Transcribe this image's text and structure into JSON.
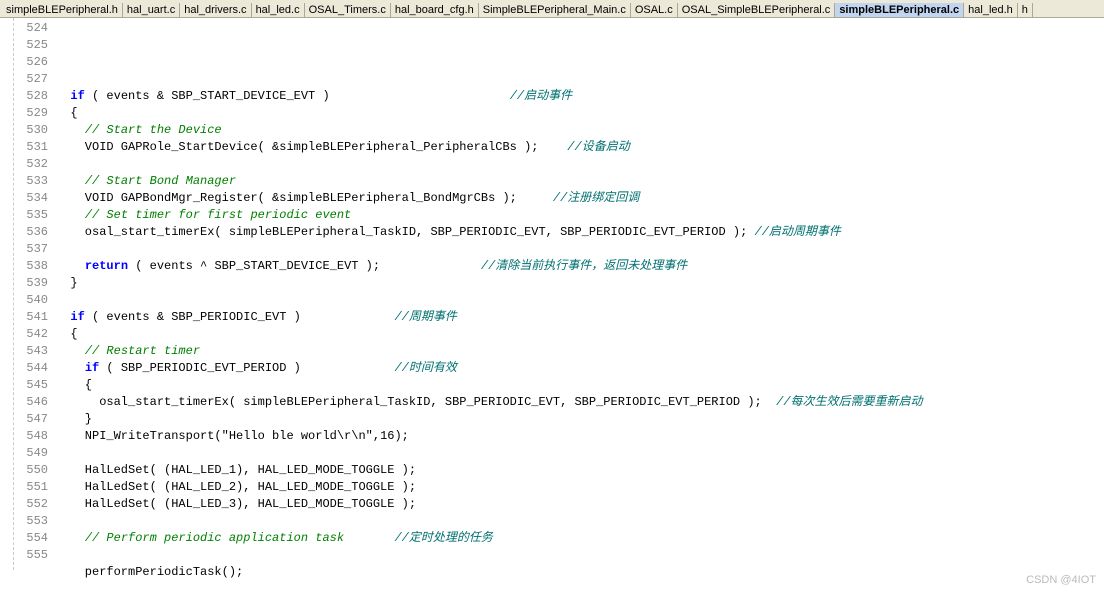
{
  "tabs": [
    {
      "label": "simpleBLEPeripheral.h",
      "active": false
    },
    {
      "label": "hal_uart.c",
      "active": false
    },
    {
      "label": "hal_drivers.c",
      "active": false
    },
    {
      "label": "hal_led.c",
      "active": false
    },
    {
      "label": "OSAL_Timers.c",
      "active": false
    },
    {
      "label": "hal_board_cfg.h",
      "active": false
    },
    {
      "label": "SimpleBLEPeripheral_Main.c",
      "active": false
    },
    {
      "label": "OSAL.c",
      "active": false
    },
    {
      "label": "OSAL_SimpleBLEPeripheral.c",
      "active": false
    },
    {
      "label": "simpleBLEPeripheral.c",
      "active": true
    },
    {
      "label": "hal_led.h",
      "active": false
    },
    {
      "label": "h",
      "active": false
    }
  ],
  "lines": [
    {
      "num": "524",
      "segs": []
    },
    {
      "num": "525",
      "segs": [
        {
          "t": "  ",
          "c": "plain"
        },
        {
          "t": "if",
          "c": "kw"
        },
        {
          "t": " ( events & SBP_START_DEVICE_EVT )                         ",
          "c": "plain"
        },
        {
          "t": "//启动事件",
          "c": "cm-cn"
        }
      ]
    },
    {
      "num": "526",
      "segs": [
        {
          "t": "  {",
          "c": "plain"
        }
      ]
    },
    {
      "num": "527",
      "segs": [
        {
          "t": "    ",
          "c": "plain"
        },
        {
          "t": "// Start the Device",
          "c": "cm"
        }
      ]
    },
    {
      "num": "528",
      "segs": [
        {
          "t": "    VOID GAPRole_StartDevice( &simpleBLEPeripheral_PeripheralCBs );    ",
          "c": "plain"
        },
        {
          "t": "//设备启动",
          "c": "cm-cn"
        }
      ]
    },
    {
      "num": "529",
      "segs": []
    },
    {
      "num": "530",
      "segs": [
        {
          "t": "    ",
          "c": "plain"
        },
        {
          "t": "// Start Bond Manager",
          "c": "cm"
        }
      ]
    },
    {
      "num": "531",
      "segs": [
        {
          "t": "    VOID GAPBondMgr_Register( &simpleBLEPeripheral_BondMgrCBs );     ",
          "c": "plain"
        },
        {
          "t": "//注册绑定回调",
          "c": "cm-cn"
        }
      ]
    },
    {
      "num": "532",
      "segs": [
        {
          "t": "    ",
          "c": "plain"
        },
        {
          "t": "// Set timer for first periodic event",
          "c": "cm"
        }
      ]
    },
    {
      "num": "533",
      "segs": [
        {
          "t": "    osal_start_timerEx( simpleBLEPeripheral_TaskID, SBP_PERIODIC_EVT, SBP_PERIODIC_EVT_PERIOD ); ",
          "c": "plain"
        },
        {
          "t": "//启动周期事件",
          "c": "cm-cn"
        }
      ]
    },
    {
      "num": "534",
      "segs": []
    },
    {
      "num": "535",
      "segs": [
        {
          "t": "    ",
          "c": "plain"
        },
        {
          "t": "return",
          "c": "kw"
        },
        {
          "t": " ( events ^ SBP_START_DEVICE_EVT );              ",
          "c": "plain"
        },
        {
          "t": "//清除当前执行事件，返回未处理事件",
          "c": "cm-cn"
        }
      ]
    },
    {
      "num": "536",
      "segs": [
        {
          "t": "  }",
          "c": "plain"
        }
      ]
    },
    {
      "num": "537",
      "segs": []
    },
    {
      "num": "538",
      "segs": [
        {
          "t": "  ",
          "c": "plain"
        },
        {
          "t": "if",
          "c": "kw"
        },
        {
          "t": " ( events & SBP_PERIODIC_EVT )             ",
          "c": "plain"
        },
        {
          "t": "//周期事件",
          "c": "cm-cn"
        }
      ]
    },
    {
      "num": "539",
      "segs": [
        {
          "t": "  {",
          "c": "plain"
        }
      ]
    },
    {
      "num": "540",
      "segs": [
        {
          "t": "    ",
          "c": "plain"
        },
        {
          "t": "// Restart timer",
          "c": "cm"
        }
      ]
    },
    {
      "num": "541",
      "segs": [
        {
          "t": "    ",
          "c": "plain"
        },
        {
          "t": "if",
          "c": "kw"
        },
        {
          "t": " ( SBP_PERIODIC_EVT_PERIOD )             ",
          "c": "plain"
        },
        {
          "t": "//时间有效",
          "c": "cm-cn"
        }
      ]
    },
    {
      "num": "542",
      "segs": [
        {
          "t": "    {",
          "c": "plain"
        }
      ]
    },
    {
      "num": "543",
      "segs": [
        {
          "t": "      osal_start_timerEx( simpleBLEPeripheral_TaskID, SBP_PERIODIC_EVT, SBP_PERIODIC_EVT_PERIOD );  ",
          "c": "plain"
        },
        {
          "t": "//每次生效后需要重新启动",
          "c": "cm-cn"
        }
      ]
    },
    {
      "num": "544",
      "segs": [
        {
          "t": "    }",
          "c": "plain"
        }
      ]
    },
    {
      "num": "545",
      "segs": [
        {
          "t": "    NPI_WriteTransport(",
          "c": "plain"
        },
        {
          "t": "\"Hello ble world\\r\\n\"",
          "c": "plain"
        },
        {
          "t": ",",
          "c": "plain"
        },
        {
          "t": "16",
          "c": "num"
        },
        {
          "t": ");",
          "c": "plain"
        }
      ]
    },
    {
      "num": "546",
      "segs": []
    },
    {
      "num": "547",
      "segs": [
        {
          "t": "    HalLedSet( (HAL_LED_1), HAL_LED_MODE_TOGGLE );",
          "c": "plain"
        }
      ]
    },
    {
      "num": "548",
      "segs": [
        {
          "t": "    HalLedSet( (HAL_LED_2), HAL_LED_MODE_TOGGLE );",
          "c": "plain"
        }
      ]
    },
    {
      "num": "549",
      "segs": [
        {
          "t": "    HalLedSet( (HAL_LED_3), HAL_LED_MODE_TOGGLE );",
          "c": "plain"
        }
      ]
    },
    {
      "num": "550",
      "segs": []
    },
    {
      "num": "551",
      "segs": [
        {
          "t": "    ",
          "c": "plain"
        },
        {
          "t": "// Perform periodic application task       ",
          "c": "cm"
        },
        {
          "t": "//定时处理的任务",
          "c": "cm-cn"
        }
      ]
    },
    {
      "num": "552",
      "segs": []
    },
    {
      "num": "553",
      "segs": [
        {
          "t": "    performPeriodicTask();",
          "c": "plain"
        }
      ]
    },
    {
      "num": "554",
      "segs": []
    },
    {
      "num": "555",
      "segs": []
    }
  ],
  "watermark": "CSDN @4IOT"
}
